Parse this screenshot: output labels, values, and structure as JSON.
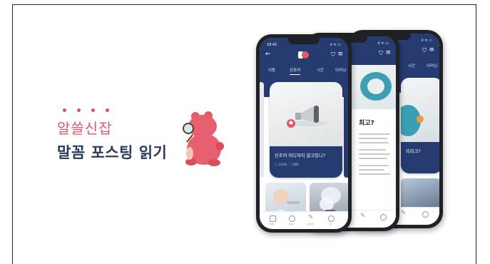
{
  "brand": {
    "headline": "알쓸신잡",
    "subtitle": "말꼼 포스팅 읽기",
    "accent_color": "#e45767",
    "navy_color": "#263b6f"
  },
  "phone_front": {
    "status_time": "18:41",
    "status_icons": "ıl ᯤ ▭",
    "tabs": [
      "이용",
      "신조어",
      "시간",
      "이러닝"
    ],
    "active_tab": "신조어",
    "card_title": "신조어 어디까지 알고있니?",
    "card_meta": "▢ 12341   ♡ 1281",
    "nav_labels": [
      "HOME",
      "BLOG",
      "WRITE",
      "MY"
    ]
  },
  "phone_middle": {
    "article_title": "최고?"
  },
  "phone_back": {
    "tabs": [
      "시간",
      "이러닝"
    ],
    "card_title": "리라고?"
  },
  "icons": [
    "back-arrow-icon",
    "bookmark-icon",
    "menu-icon",
    "home-icon",
    "blog-icon",
    "pencil-icon",
    "person-icon"
  ]
}
